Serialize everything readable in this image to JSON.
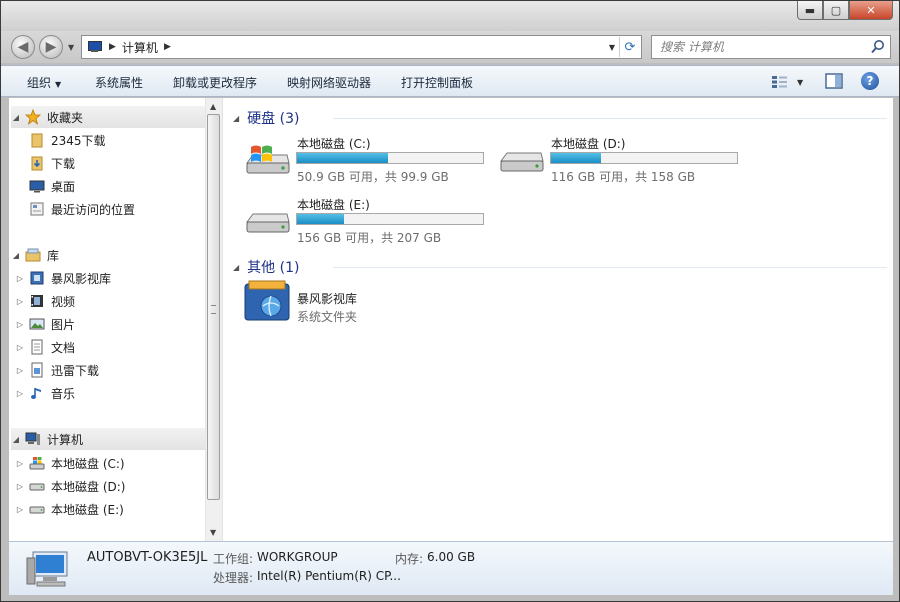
{
  "window": {
    "buttons": {
      "minimize": "▬",
      "maximize": "▢",
      "close": "✕"
    }
  },
  "address": {
    "crumbs": [
      "计算机"
    ],
    "search_placeholder": "搜索 计算机"
  },
  "toolbar": {
    "organize": "组织",
    "system_properties": "系统属性",
    "uninstall": "卸载或更改程序",
    "map_drive": "映射网络驱动器",
    "control_panel": "打开控制面板"
  },
  "nav": {
    "favorites": {
      "label": "收藏夹",
      "items": [
        {
          "label": "2345下载",
          "icon": "folder-icon"
        },
        {
          "label": "下载",
          "icon": "download-folder-icon"
        },
        {
          "label": "桌面",
          "icon": "desktop-icon"
        },
        {
          "label": "最近访问的位置",
          "icon": "recent-places-icon"
        }
      ]
    },
    "libraries": {
      "label": "库",
      "items": [
        {
          "label": "暴风影视库",
          "icon": "video-library-icon"
        },
        {
          "label": "视频",
          "icon": "video-icon"
        },
        {
          "label": "图片",
          "icon": "picture-icon"
        },
        {
          "label": "文档",
          "icon": "document-icon"
        },
        {
          "label": "迅雷下载",
          "icon": "thunder-download-icon"
        },
        {
          "label": "音乐",
          "icon": "music-icon"
        }
      ]
    },
    "computer": {
      "label": "计算机",
      "items": [
        {
          "label": "本地磁盘 (C:)",
          "icon": "system-drive-icon"
        },
        {
          "label": "本地磁盘 (D:)",
          "icon": "drive-icon"
        },
        {
          "label": "本地磁盘 (E:)",
          "icon": "drive-icon"
        }
      ]
    }
  },
  "content": {
    "hard_drives": {
      "title": "硬盘 (3)",
      "drives": [
        {
          "name": "本地磁盘 (C:)",
          "free": "50.9 GB 可用，共 99.9 GB",
          "used_fraction": 0.49
        },
        {
          "name": "本地磁盘 (D:)",
          "free": "116 GB 可用，共 158 GB",
          "used_fraction": 0.27
        },
        {
          "name": "本地磁盘 (E:)",
          "free": "156 GB 可用，共 207 GB",
          "used_fraction": 0.25
        }
      ]
    },
    "other": {
      "title": "其他 (1)",
      "items": [
        {
          "name": "暴风影视库",
          "type": "系统文件夹"
        }
      ]
    }
  },
  "details": {
    "computer_name": "AUTOBVT-OK3E5JL",
    "workgroup_label": "工作组:",
    "workgroup_value": "WORKGROUP",
    "memory_label": "内存:",
    "memory_value": "6.00 GB",
    "processor_label": "处理器:",
    "processor_value": "Intel(R) Pentium(R) CP..."
  },
  "colors": {
    "accent_title": "#1e3287",
    "bar_fill": "#1a8ec4",
    "toolbar_bg": "#dfe8f2"
  }
}
